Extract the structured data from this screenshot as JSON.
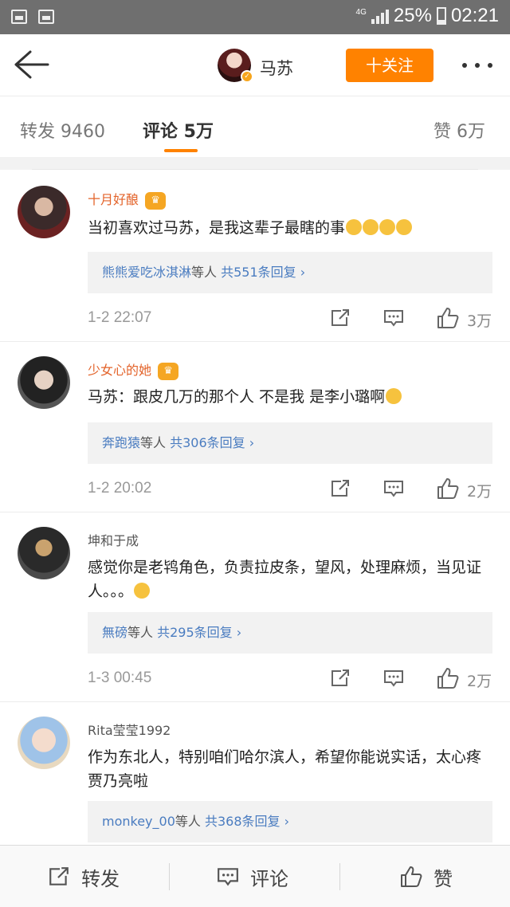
{
  "status_bar": {
    "network": "4G",
    "battery": "25%",
    "time": "02:21"
  },
  "header": {
    "name": "马苏",
    "follow_label": "十关注"
  },
  "tabs": {
    "repost": "转发 9460",
    "comments": "评论 5万",
    "likes": "赞 6万"
  },
  "comments": [
    {
      "user": "十月好酿",
      "vip": true,
      "text": "当初喜欢过马苏，是我这辈子最瞎的事",
      "emoji_count": 4,
      "reply_users": "熊熊爱吃冰淇淋",
      "reply_suffix": "等人",
      "reply_count": "共551条回复",
      "time": "1-2 22:07",
      "likes": "3万"
    },
    {
      "user": "少女心的她",
      "vip": true,
      "text": "马苏：跟皮几万的那个人 不是我 是李小璐啊",
      "emoji_count": 1,
      "reply_users": "奔跑猿",
      "reply_suffix": "等人",
      "reply_count": "共306条回复",
      "time": "1-2 20:02",
      "likes": "2万"
    },
    {
      "user": "坤和于成",
      "vip": false,
      "text": "感觉你是老鸨角色，负责拉皮条，望风，处理麻烦，当见证人。。。",
      "emoji_count": 1,
      "reply_users": "無磅",
      "reply_suffix": "等人",
      "reply_count": "共295条回复",
      "time": "1-3 00:45",
      "likes": "2万"
    },
    {
      "user": "Rita莹莹1992",
      "vip": false,
      "text": "作为东北人，特别咱们哈尔滨人，希望你能说实话，太心疼贾乃亮啦",
      "emoji_count": 0,
      "reply_users": "monkey_00",
      "reply_suffix": "等人",
      "reply_count": "共368条回复"
    }
  ],
  "bottom_bar": {
    "repost": "转发",
    "comment": "评论",
    "like": "赞"
  },
  "colors": {
    "accent": "#ff8200",
    "link": "#4a7cc0",
    "vip_name": "#e3632a"
  }
}
